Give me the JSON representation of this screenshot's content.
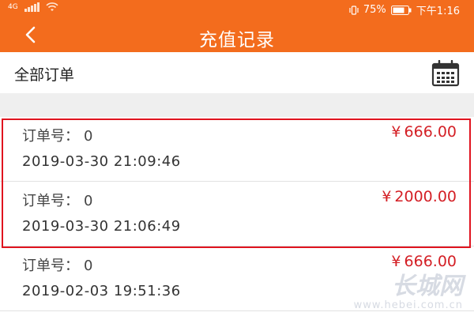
{
  "status_bar": {
    "network": "4G",
    "battery_percent": "75%",
    "time": "下午1:16"
  },
  "nav": {
    "title": "充值记录",
    "back_icon": "chevron-left-icon"
  },
  "filter": {
    "label": "全部订单",
    "calendar_icon": "calendar-icon"
  },
  "records": [
    {
      "order_label": "订单号：",
      "order_no": "0",
      "currency": "¥",
      "amount": "666.00",
      "time": "2019-03-30 21:09:46"
    },
    {
      "order_label": "订单号：",
      "order_no": "0",
      "currency": "¥",
      "amount": "2000.00",
      "time": "2019-03-30 21:06:49"
    },
    {
      "order_label": "订单号：",
      "order_no": "0",
      "currency": "¥",
      "amount": "666.00",
      "time": "2019-02-03 19:51:36"
    }
  ],
  "watermark": {
    "logo": "长城网",
    "url": "www.hebei.com.cn"
  },
  "colors": {
    "brand_orange": "#f36c1d",
    "amount_red": "#d41f25",
    "highlight_red": "#e0141f"
  }
}
